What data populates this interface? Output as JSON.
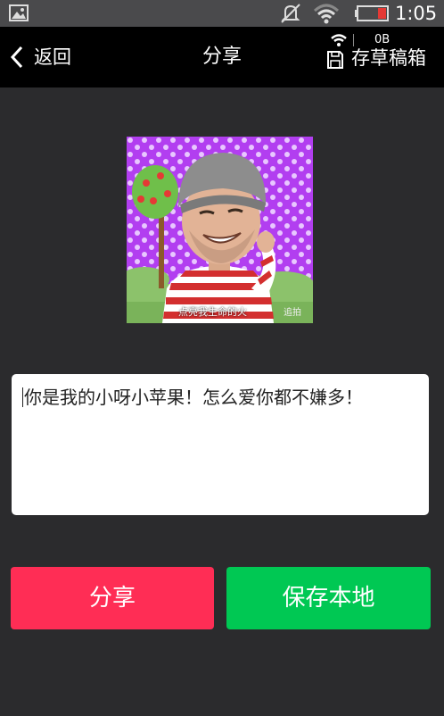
{
  "status_bar": {
    "time": "1:05",
    "icons": [
      "gallery-icon",
      "mute-icon",
      "wifi-icon",
      "battery-icon"
    ]
  },
  "header": {
    "back_label": "返回",
    "title": "分享",
    "drafts_label": "存草稿箱",
    "data_rate": "0B"
  },
  "preview": {
    "caption": "点亮我生命的火",
    "tag": "追拍"
  },
  "message": {
    "text": "你是我的小呀小苹果！怎么爱你都不嫌多！"
  },
  "actions": {
    "share_label": "分享",
    "save_local_label": "保存本地"
  },
  "colors": {
    "background": "#2b2b2d",
    "share": "#ff2d55",
    "save_local": "#00c853",
    "preview_bg": "#b23ef0"
  }
}
